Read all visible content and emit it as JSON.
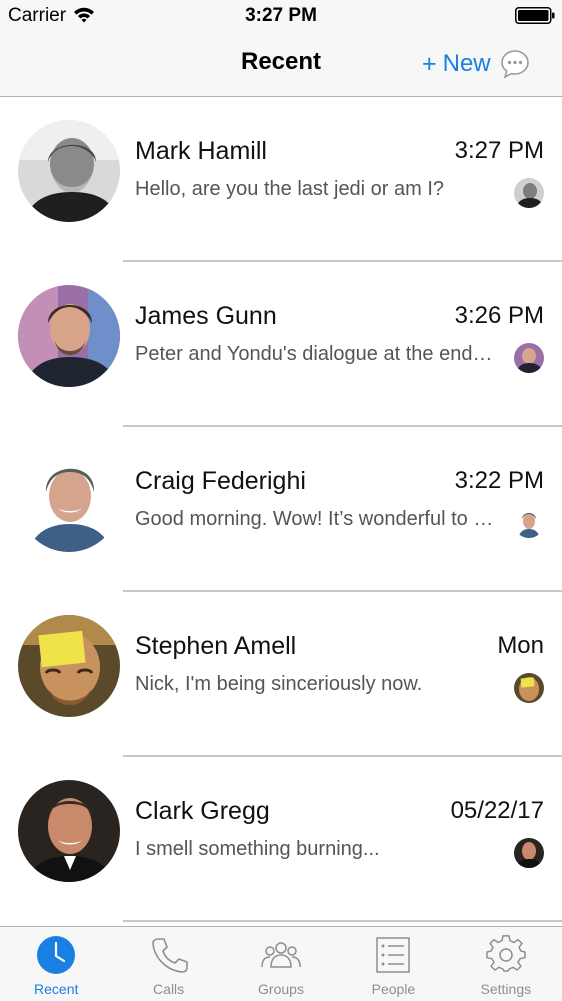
{
  "status_bar": {
    "carrier": "Carrier",
    "time": "3:27 PM",
    "icons": [
      "wifi-icon",
      "battery-icon"
    ]
  },
  "nav": {
    "title": "Recent",
    "new_plus": "+",
    "new_label": "New",
    "new_icon": "chat-bubble-icon"
  },
  "conversations": [
    {
      "name": "Mark Hamill",
      "time": "3:27 PM",
      "preview": "Hello, are you the last jedi or am I?"
    },
    {
      "name": "James Gunn",
      "time": "3:26 PM",
      "preview": "Peter and Yondu's dialogue at the end of the movie"
    },
    {
      "name": "Craig Federighi",
      "time": "3:22 PM",
      "preview": "Good morning. Wow! It’s wonderful to be here"
    },
    {
      "name": "Stephen Amell",
      "time": "Mon",
      "preview": "Nick, I'm being sinceriously now."
    },
    {
      "name": "Clark Gregg",
      "time": "05/22/17",
      "preview": "I smell something burning..."
    }
  ],
  "tabs": [
    {
      "label": "Recent",
      "icon": "clock-icon",
      "active": true
    },
    {
      "label": "Calls",
      "icon": "phone-icon",
      "active": false
    },
    {
      "label": "Groups",
      "icon": "groups-icon",
      "active": false
    },
    {
      "label": "People",
      "icon": "people-list-icon",
      "active": false
    },
    {
      "label": "Settings",
      "icon": "gear-icon",
      "active": false
    }
  ],
  "colors": {
    "accent": "#1a7fe3",
    "bar_background": "#f7f7f7",
    "divider": "#c8c8c8"
  }
}
